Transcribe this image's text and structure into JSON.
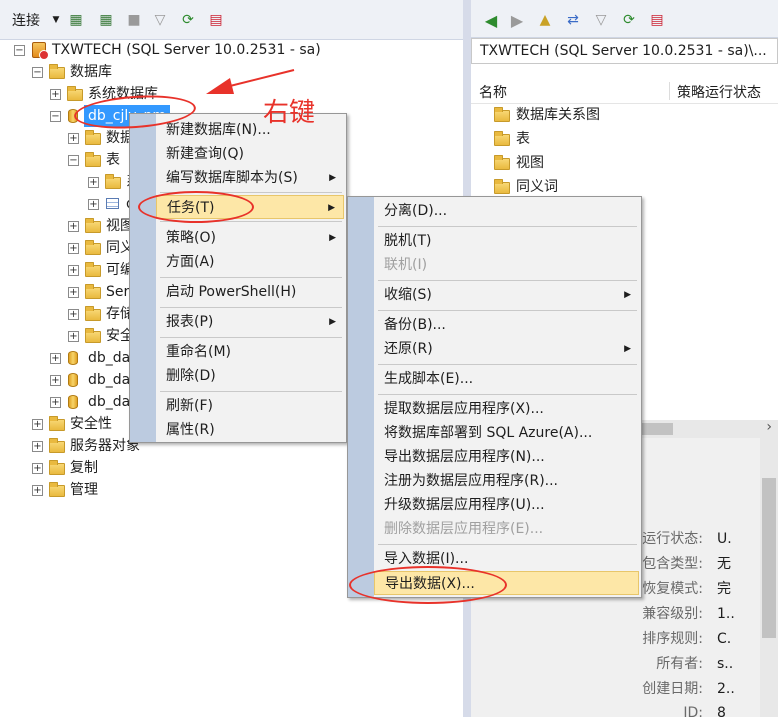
{
  "left_toolbar": {
    "connect_label": "连接",
    "icons": [
      "connect-dropdown-icon",
      "new-connection-icon",
      "disconnect-icon",
      "stop-icon",
      "filter-icon",
      "refresh-icon",
      "activity-monitor-icon"
    ]
  },
  "tree": {
    "server": "TXWTECH (SQL Server 10.0.2531 - sa)",
    "databases": "数据库",
    "system_dbs": "系统数据库",
    "db_selected": "db_cjlv_pm",
    "db_children": {
      "diagrams": "数据库关系图",
      "tables": "表",
      "table_child1": "系",
      "table_child2": "d",
      "views": "视图",
      "synonyms": "同义",
      "programmability": "可编",
      "service_broker": "Ser",
      "storage": "存储",
      "security": "安全"
    },
    "db2": "db_da",
    "db3": "db_da",
    "db4": "db_da",
    "security": "安全性",
    "server_objects": "服务器对象",
    "replication": "复制",
    "management": "管理"
  },
  "annotation": {
    "label": "右键",
    "color": "#e8322a"
  },
  "context_menu": {
    "new_database": "新建数据库(N)...",
    "new_query": "新建查询(Q)",
    "script_as": "编写数据库脚本为(S)",
    "tasks": "任务(T)",
    "policies": "策略(O)",
    "facets": "方面(A)",
    "powershell": "启动 PowerShell(H)",
    "reports": "报表(P)",
    "rename": "重命名(M)",
    "delete": "删除(D)",
    "refresh": "刷新(F)",
    "properties": "属性(R)"
  },
  "tasks_menu": {
    "detach": "分离(D)...",
    "offline": "脱机(T)",
    "online": "联机(I)",
    "shrink": "收缩(S)",
    "backup": "备份(B)...",
    "restore": "还原(R)",
    "generate_scripts": "生成脚本(E)...",
    "extract_dac": "提取数据层应用程序(X)...",
    "deploy_azure": "将数据库部署到 SQL Azure(A)...",
    "export_dac": "导出数据层应用程序(N)...",
    "register_dac": "注册为数据层应用程序(R)...",
    "upgrade_dac": "升级数据层应用程序(U)...",
    "delete_dac": "删除数据层应用程序(E)...",
    "import_data": "导入数据(I)...",
    "export_data": "导出数据(X)..."
  },
  "right_panel": {
    "icons": [
      "back-icon",
      "forward-icon",
      "up-folder-icon",
      "sync-icon",
      "filter-icon",
      "refresh-icon",
      "stop-icon"
    ],
    "title": "TXWTECH (SQL Server 10.0.2531 - sa)\\...",
    "col_name": "名称",
    "col_policy": "策略运行状态",
    "items": [
      "数据库关系图",
      "表",
      "视图",
      "同义词"
    ],
    "props": [
      {
        "label": "运行状态:",
        "value": "U."
      },
      {
        "label": "包含类型:",
        "value": "无"
      },
      {
        "label": "恢复模式:",
        "value": "完"
      },
      {
        "label": "兼容级别:",
        "value": "1.."
      },
      {
        "label": "排序规则:",
        "value": "C."
      },
      {
        "label": "所有者:",
        "value": "s.."
      },
      {
        "label": "创建日期:",
        "value": "2.."
      },
      {
        "label": "ID:",
        "value": "8"
      }
    ]
  },
  "colors": {
    "menu_highlight": "#fde7a7",
    "annotation_red": "#e8322a",
    "selection_blue": "#3399ff"
  }
}
